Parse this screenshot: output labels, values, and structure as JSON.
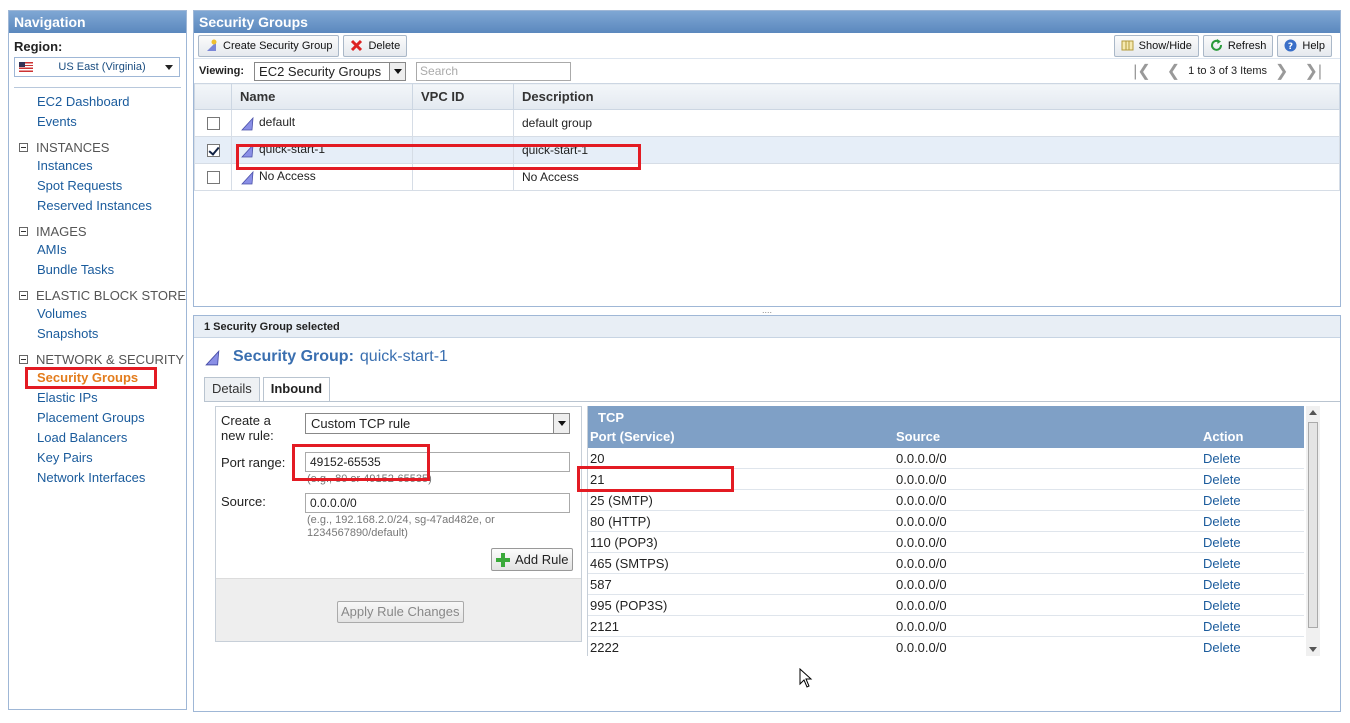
{
  "nav": {
    "title": "Navigation",
    "region_label": "Region:",
    "region_value": "US East (Virginia)",
    "dashboard": "EC2 Dashboard",
    "events": "Events",
    "sections": {
      "instances": "INSTANCES",
      "images": "IMAGES",
      "ebs": "ELASTIC BLOCK STORE",
      "network": "NETWORK & SECURITY"
    },
    "links": {
      "instances": "Instances",
      "spot": "Spot Requests",
      "reserved": "Reserved Instances",
      "amis": "AMIs",
      "bundle": "Bundle Tasks",
      "volumes": "Volumes",
      "snapshots": "Snapshots",
      "security_groups": "Security Groups",
      "elastic_ips": "Elastic IPs",
      "placement": "Placement Groups",
      "load_balancers": "Load Balancers",
      "key_pairs": "Key Pairs",
      "network_interfaces": "Network Interfaces"
    }
  },
  "main": {
    "title": "Security Groups",
    "toolbar": {
      "create": "Create Security Group",
      "delete": "Delete",
      "showhide": "Show/Hide",
      "refresh": "Refresh",
      "help": "Help"
    },
    "viewing_label": "Viewing:",
    "viewing_value": "EC2 Security Groups",
    "search_placeholder": "Search",
    "pager_text": "1 to 3 of 3 Items",
    "columns": [
      "Name",
      "VPC ID",
      "Description"
    ],
    "rows": [
      {
        "name": "default",
        "vpc": "",
        "description": "default group",
        "checked": false
      },
      {
        "name": "quick-start-1",
        "vpc": "",
        "description": "quick-start-1",
        "checked": true
      },
      {
        "name": "No Access",
        "vpc": "",
        "description": "No Access",
        "checked": false
      }
    ]
  },
  "detail": {
    "selected_text": "1 Security Group selected",
    "title_label": "Security Group:",
    "title_value": "quick-start-1",
    "tabs": [
      "Details",
      "Inbound"
    ],
    "active_tab": "Inbound",
    "form": {
      "create_label": "Create a new rule:",
      "rule_type": "Custom TCP rule",
      "port_label": "Port range:",
      "port_value": "49152-65535",
      "port_hint": "(e.g., 80 or 49152-65535)",
      "source_label": "Source:",
      "source_value": "0.0.0.0/0",
      "source_hint": "(e.g., 192.168.2.0/24, sg-47ad482e, or 1234567890/default)",
      "add_rule": "Add Rule",
      "apply": "Apply Rule Changes"
    },
    "rules": {
      "protocol": "TCP",
      "columns": [
        "Port (Service)",
        "Source",
        "Action"
      ],
      "rows": [
        {
          "port": "20",
          "source": "0.0.0.0/0",
          "action": "Delete"
        },
        {
          "port": "21",
          "source": "0.0.0.0/0",
          "action": "Delete"
        },
        {
          "port": "25 (SMTP)",
          "source": "0.0.0.0/0",
          "action": "Delete"
        },
        {
          "port": "80 (HTTP)",
          "source": "0.0.0.0/0",
          "action": "Delete"
        },
        {
          "port": "110 (POP3)",
          "source": "0.0.0.0/0",
          "action": "Delete"
        },
        {
          "port": "465 (SMTPS)",
          "source": "0.0.0.0/0",
          "action": "Delete"
        },
        {
          "port": "587",
          "source": "0.0.0.0/0",
          "action": "Delete"
        },
        {
          "port": "995 (POP3S)",
          "source": "0.0.0.0/0",
          "action": "Delete"
        },
        {
          "port": "2121",
          "source": "0.0.0.0/0",
          "action": "Delete"
        },
        {
          "port": "2222",
          "source": "0.0.0.0/0",
          "action": "Delete"
        }
      ]
    }
  },
  "colors": {
    "header_blue": "#5b88be",
    "link_blue": "#1a5b9c",
    "active_orange": "#e37c1c",
    "highlight_red": "#e31b23"
  }
}
